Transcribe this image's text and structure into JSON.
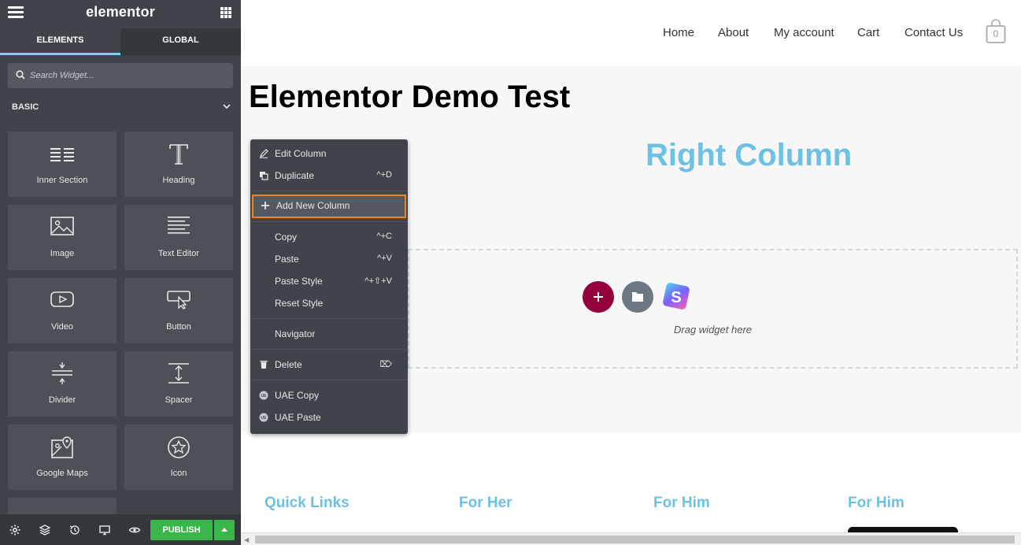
{
  "colors": {
    "sidebar_bg": "#3f444b",
    "accent_cyan": "#71d7f7",
    "column_title": "#6ec1e4",
    "publish_green": "#39b54a",
    "add_section": "#93003c",
    "highlight_border": "#f58220"
  },
  "sidebar": {
    "logo": "elementor",
    "tabs": [
      {
        "label": "ELEMENTS",
        "active": true
      },
      {
        "label": "GLOBAL",
        "active": false
      }
    ],
    "search": {
      "placeholder": "Search Widget..."
    },
    "category": "BASIC",
    "widgets": [
      {
        "label": "Inner Section",
        "icon": "inner-section-icon"
      },
      {
        "label": "Heading",
        "icon": "heading-icon"
      },
      {
        "label": "Image",
        "icon": "image-icon"
      },
      {
        "label": "Text Editor",
        "icon": "text-editor-icon"
      },
      {
        "label": "Video",
        "icon": "video-icon"
      },
      {
        "label": "Button",
        "icon": "button-icon"
      },
      {
        "label": "Divider",
        "icon": "divider-icon"
      },
      {
        "label": "Spacer",
        "icon": "spacer-icon"
      },
      {
        "label": "Google Maps",
        "icon": "google-maps-icon"
      },
      {
        "label": "Icon",
        "icon": "star-icon"
      }
    ],
    "footer": {
      "publish_label": "PUBLISH"
    }
  },
  "site": {
    "nav": [
      "Home",
      "About",
      "My account",
      "Cart",
      "Contact Us"
    ],
    "cart_count": "0",
    "page_title": "Elementor Demo Test",
    "left_column_title_visible": "n",
    "right_column_title": "Right Column",
    "drag_hint": "Drag widget here",
    "footer_titles": [
      "Quick Links",
      "For Her",
      "For Him",
      "For Him"
    ]
  },
  "context_menu": {
    "items": [
      {
        "label": "Edit Column",
        "shortcut": "",
        "icon": "pencil-icon"
      },
      {
        "label": "Duplicate",
        "shortcut": "^+D",
        "icon": "duplicate-icon"
      },
      {
        "label": "Add New Column",
        "shortcut": "",
        "icon": "plus-icon",
        "highlighted": true
      },
      {
        "label": "Copy",
        "shortcut": "^+C",
        "icon": ""
      },
      {
        "label": "Paste",
        "shortcut": "^+V",
        "icon": ""
      },
      {
        "label": "Paste Style",
        "shortcut": "^+⇧+V",
        "icon": ""
      },
      {
        "label": "Reset Style",
        "shortcut": "",
        "icon": ""
      },
      {
        "label": "Navigator",
        "shortcut": "",
        "icon": ""
      },
      {
        "label": "Delete",
        "shortcut": "⌦",
        "icon": "trash-icon"
      },
      {
        "label": "UAE Copy",
        "shortcut": "",
        "icon": "uae-icon"
      },
      {
        "label": "UAE Paste",
        "shortcut": "",
        "icon": "uae-icon"
      }
    ]
  }
}
